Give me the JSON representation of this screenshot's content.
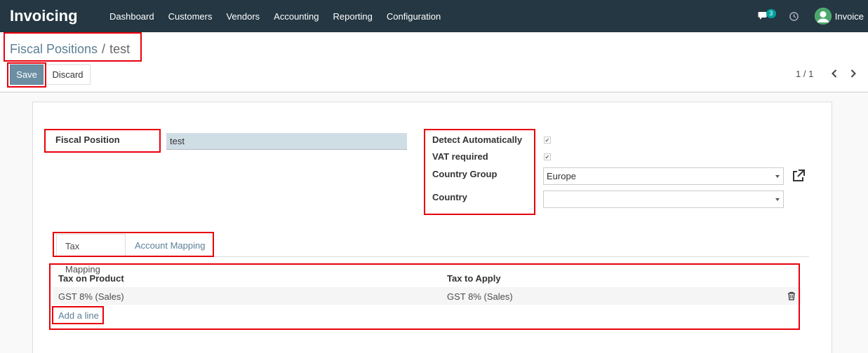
{
  "app": {
    "title": "Invoicing"
  },
  "menu": [
    "Dashboard",
    "Customers",
    "Vendors",
    "Accounting",
    "Reporting",
    "Configuration"
  ],
  "systray": {
    "messages_count": "3",
    "user_name": "Invoice"
  },
  "breadcrumb": {
    "parent": "Fiscal Positions",
    "separator": "/",
    "current": "test"
  },
  "toolbar": {
    "save_label": "Save",
    "discard_label": "Discard"
  },
  "pager": {
    "value": "1 / 1"
  },
  "form": {
    "fiscal_position_label": "Fiscal Position",
    "fiscal_position_value": "test",
    "detect_automatically_label": "Detect Automatically",
    "detect_automatically_checked": true,
    "vat_required_label": "VAT required",
    "vat_required_checked": true,
    "country_group_label": "Country Group",
    "country_group_value": "Europe",
    "country_label": "Country",
    "country_value": ""
  },
  "tabs": [
    {
      "label": "Tax Mapping",
      "active": true
    },
    {
      "label": "Account Mapping",
      "active": false
    }
  ],
  "tax_table": {
    "columns": [
      "Tax on Product",
      "Tax to Apply"
    ],
    "rows": [
      {
        "tax_on_product": "GST 8% (Sales)",
        "tax_to_apply": "GST 8% (Sales)"
      }
    ],
    "add_line_label": "Add a line"
  },
  "colors": {
    "navbar": "#243742",
    "accent": "#5b7f95",
    "highlight": "#e8000b"
  }
}
